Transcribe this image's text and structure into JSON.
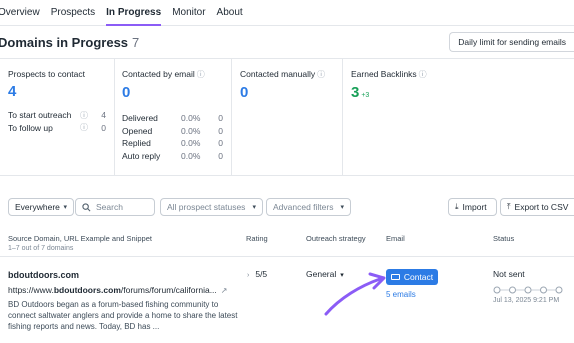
{
  "nav": {
    "tabs": [
      {
        "label": "Overview"
      },
      {
        "label": "Prospects"
      },
      {
        "label": "In Progress"
      },
      {
        "label": "Monitor"
      },
      {
        "label": "About"
      }
    ],
    "active": "In Progress"
  },
  "header": {
    "title": "Domains in Progress",
    "count": "7",
    "daily_limit_label": "Daily limit for sending emails"
  },
  "stats": {
    "prospects": {
      "label": "Prospects to contact",
      "value": "4",
      "rows": [
        {
          "label": "To start outreach",
          "num": "4"
        },
        {
          "label": "To follow up",
          "num": "0"
        }
      ]
    },
    "email": {
      "label": "Contacted by email",
      "value": "0",
      "rows": [
        {
          "label": "Delivered",
          "pct": "0.0%",
          "num": "0"
        },
        {
          "label": "Opened",
          "pct": "0.0%",
          "num": "0"
        },
        {
          "label": "Replied",
          "pct": "0.0%",
          "num": "0"
        },
        {
          "label": "Auto reply",
          "pct": "0.0%",
          "num": "0"
        }
      ]
    },
    "manual": {
      "label": "Contacted manually",
      "value": "0"
    },
    "backlinks": {
      "label": "Earned Backlinks",
      "value": "3",
      "delta": "+3"
    }
  },
  "filters": {
    "scope": "Everywhere",
    "search_placeholder": "Search",
    "statuses": "All prospect statuses",
    "advanced": "Advanced filters",
    "import_label": "Import",
    "export_label": "Export to CSV"
  },
  "table": {
    "columns": {
      "domain": "Source Domain, URL Example and Snippet",
      "rating": "Rating",
      "strategy": "Outreach strategy",
      "email": "Email",
      "status": "Status"
    },
    "range_text": "1–7 out of 7 domains",
    "rows": [
      {
        "domain": "bdoutdoors.com",
        "url_prefix": "https://www.",
        "url_bold": "bdoutdoors.com",
        "url_suffix": "/forums/forum/california...",
        "snippet": "BD Outdoors began as a forum-based fishing community to connect saltwater anglers and provide a home to share the latest fishing reports and news. Today, BD has ...",
        "rating": "5/5",
        "strategy": "General",
        "contact_label": "Contact",
        "emails_count": "5 emails",
        "status": "Not sent",
        "status_time": "Jul 13, 2025 9:21 PM"
      }
    ]
  },
  "colors": {
    "accent_blue": "#2c7be5",
    "active_tab": "#8b5cf6",
    "green": "#18a058",
    "arrow_purple": "#8b5cf6"
  }
}
